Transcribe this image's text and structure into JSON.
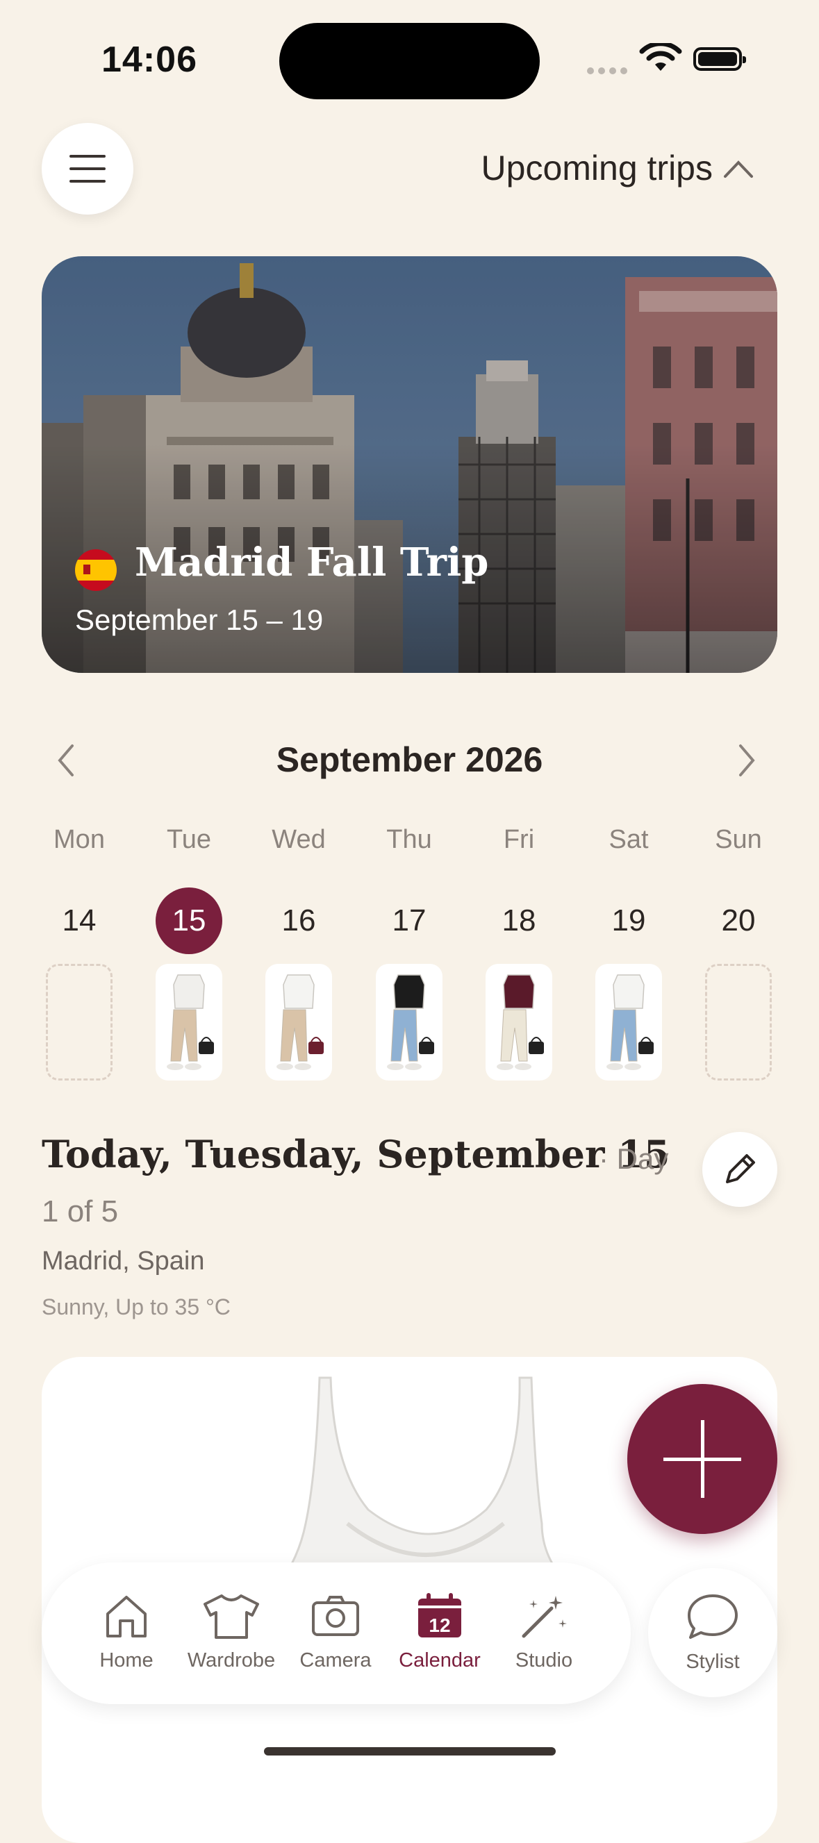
{
  "status": {
    "time": "14:06"
  },
  "header": {
    "trips_label": "Upcoming trips"
  },
  "trip": {
    "title": "Madrid Fall Trip",
    "dates": "September 15 – 19",
    "flag": "spain-flag"
  },
  "calendar": {
    "month": "September 2026",
    "days": [
      {
        "name": "Mon",
        "num": "14",
        "has_outfit": false,
        "selected": false
      },
      {
        "name": "Tue",
        "num": "15",
        "has_outfit": true,
        "selected": true
      },
      {
        "name": "Wed",
        "num": "16",
        "has_outfit": true,
        "selected": false
      },
      {
        "name": "Thu",
        "num": "17",
        "has_outfit": true,
        "selected": false
      },
      {
        "name": "Fri",
        "num": "18",
        "has_outfit": true,
        "selected": false
      },
      {
        "name": "Sat",
        "num": "19",
        "has_outfit": true,
        "selected": false
      },
      {
        "name": "Sun",
        "num": "20",
        "has_outfit": false,
        "selected": false
      }
    ]
  },
  "today": {
    "title": "Today, Tuesday, September 15",
    "day_count_a": "· Day",
    "day_count_b": "1 of 5",
    "city": "Madrid, Spain",
    "weather": "Sunny, Up to 35 °C"
  },
  "tabs": [
    {
      "label": "Home",
      "icon": "home-icon"
    },
    {
      "label": "Wardrobe",
      "icon": "tshirt-icon"
    },
    {
      "label": "Camera",
      "icon": "camera-icon"
    },
    {
      "label": "Calendar",
      "icon": "calendar-icon",
      "badge": "12"
    },
    {
      "label": "Studio",
      "icon": "magic-wand-icon"
    }
  ],
  "stylist": {
    "label": "Stylist"
  },
  "colors": {
    "accent": "#7a1f3d",
    "background": "#f8f2e8"
  }
}
